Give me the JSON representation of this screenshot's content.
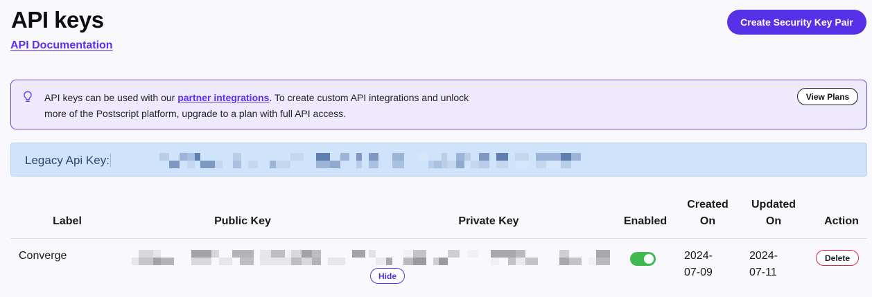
{
  "header": {
    "title": "API keys",
    "doc_link": "API Documentation",
    "create_button": "Create Security Key Pair"
  },
  "banner": {
    "text_before": "API keys can be used with our ",
    "link": "partner integrations",
    "text_after": ". To create custom API integrations and unlock more of the Postscript platform, upgrade to a plan with full API access.",
    "button": "View Plans",
    "icon": "lightbulb-icon"
  },
  "legacy": {
    "label": "Legacy Api Key:",
    "value_state": "redacted"
  },
  "table": {
    "headers": {
      "label": "Label",
      "public_key": "Public Key",
      "private_key": "Private Key",
      "enabled": "Enabled",
      "created_on": "Created On",
      "updated_on": "Updated On",
      "action": "Action"
    },
    "rows": [
      {
        "label": "Converge",
        "public_key": "redacted",
        "private_key": "redacted",
        "hide_button": "Hide",
        "enabled": true,
        "created_on": "2024-07-09",
        "updated_on": "2024-07-11",
        "action": "Delete"
      }
    ]
  },
  "colors": {
    "accent": "#5530e6",
    "banner_bg": "#efe9fd",
    "legacy_bg": "#cfe4fb",
    "toggle_on": "#3fb950",
    "danger": "#e0264a"
  }
}
